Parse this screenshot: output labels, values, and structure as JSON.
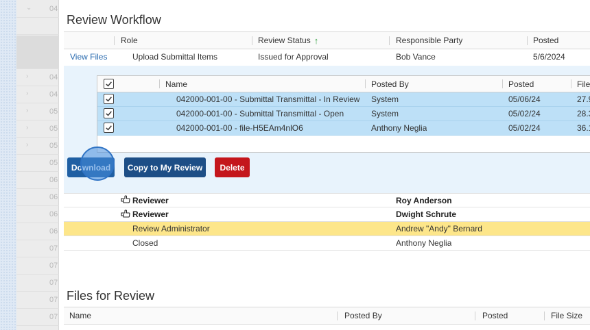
{
  "background_list": {
    "rows": [
      {
        "num": "04",
        "chev": "⌄"
      },
      {
        "num": "",
        "chev": ""
      },
      {
        "num": "",
        "chev": ""
      },
      {
        "num": "",
        "chev": ""
      },
      {
        "num": "04",
        "chev": "›"
      },
      {
        "num": "04",
        "chev": "›"
      },
      {
        "num": "05",
        "chev": "›"
      },
      {
        "num": "05",
        "chev": "›"
      },
      {
        "num": "05",
        "chev": "›"
      },
      {
        "num": "05",
        "chev": ""
      },
      {
        "num": "06",
        "chev": ""
      },
      {
        "num": "06",
        "chev": ""
      },
      {
        "num": "06",
        "chev": ""
      },
      {
        "num": "06",
        "chev": ""
      },
      {
        "num": "07",
        "chev": ""
      },
      {
        "num": "07",
        "chev": ""
      },
      {
        "num": "07",
        "chev": ""
      },
      {
        "num": "07",
        "chev": ""
      },
      {
        "num": "07",
        "chev": ""
      }
    ]
  },
  "review_workflow": {
    "title": "Review Workflow",
    "columns": {
      "role": "Role",
      "review_status": "Review Status",
      "responsible_party": "Responsible Party",
      "posted": "Posted"
    },
    "sort_arrow": "↑",
    "row": {
      "view_files": "View Files",
      "role": "Upload Submittal Items",
      "status": "Issued for Approval",
      "party": "Bob Vance",
      "posted": "5/6/2024"
    }
  },
  "files_grid": {
    "columns": {
      "name": "Name",
      "posted_by": "Posted By",
      "posted": "Posted",
      "file": "File"
    },
    "rows": [
      {
        "name": "042000-001-00 - Submittal Transmittal - In Review",
        "posted_by": "System",
        "posted": "05/06/24",
        "size": "27.9"
      },
      {
        "name": "042000-001-00 - Submittal Transmittal - Open",
        "posted_by": "System",
        "posted": "05/02/24",
        "size": "28.3"
      },
      {
        "name": "042000-001-00 - file-H5EAm4nlO6",
        "posted_by": "Anthony Neglia",
        "posted": "05/02/24",
        "size": "36.1"
      }
    ]
  },
  "buttons": {
    "download": "Download",
    "copy": "Copy to My Review",
    "delete": "Delete"
  },
  "workflow_steps": [
    {
      "role": "Reviewer",
      "party": "Roy Anderson",
      "bold": true,
      "icon": "hand-pointer-icon"
    },
    {
      "role": "Reviewer",
      "party": "Dwight Schrute",
      "bold": true,
      "icon": "hand-pointer-icon"
    },
    {
      "role": "Review Administrator",
      "party": "Andrew \"Andy\" Bernard",
      "bold": false,
      "highlight": true
    },
    {
      "role": "Closed",
      "party": "Anthony Neglia",
      "bold": false
    }
  ],
  "files_for_review": {
    "title": "Files for Review",
    "columns": {
      "name": "Name",
      "posted_by": "Posted By",
      "posted": "Posted",
      "file_size": "File Size"
    }
  },
  "colors": {
    "accent": "#1f5fa3",
    "delete": "#c4161c",
    "selected_row": "#bde0f7",
    "highlight_row": "#fde68a",
    "sort_arrow": "#2e9d3b"
  }
}
